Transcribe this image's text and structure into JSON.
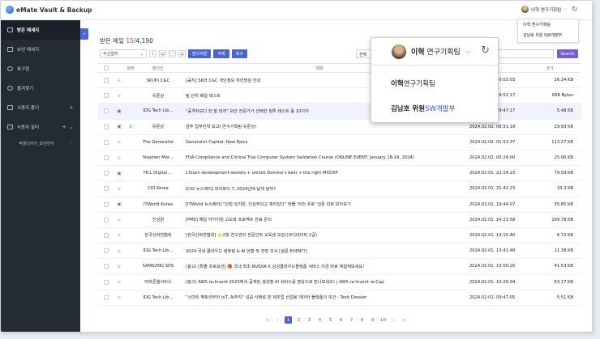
{
  "app": {
    "title": "eMate Vault & Backup"
  },
  "header": {
    "user": "이혁 연구기획팀",
    "caret": "⌵",
    "refresh": "↻"
  },
  "top_dropdown": {
    "items": [
      "이혁 연구기획팀",
      "김남호 위원 SW개발부"
    ]
  },
  "sidebar": {
    "items": [
      {
        "label": "받은 메세지"
      },
      {
        "label": "보낸 메세지"
      },
      {
        "label": "복구함"
      },
      {
        "label": "즐겨찾기"
      },
      {
        "label": "사용자 폴더",
        "plus": "+"
      },
      {
        "label": "사용자 필터",
        "plus": "+",
        "chevron": "⌄"
      }
    ],
    "sub": {
      "label": "액셀티어어_보낸편지",
      "dots": "⋮"
    }
  },
  "collapse_icon": "‹",
  "main": {
    "title": "받은 메일",
    "count_new": "15",
    "count_total": "/4,190"
  },
  "toolbar": {
    "sort": "수신일자",
    "sort_caret": "⌄",
    "down_arrow": "↓",
    "tools": [
      "▤",
      "▢",
      "▤"
    ],
    "btn_backup": "원다지원",
    "btn_delete": "삭제",
    "btn_restore": "복구",
    "search_scope": "전체",
    "search_button": "Search"
  },
  "table": {
    "headers": {
      "att": "첨부",
      "from": "발신인",
      "subject": "제목",
      "size": "크기"
    },
    "rows": [
      {
        "star": false,
        "att": "",
        "from": "SK(주) C&C",
        "subject": "[공지] SK와 C&C 개인정보 처리방침 안내",
        "date": "2024.02.02. 10:03:03",
        "size": "26.34 KB"
      },
      {
        "star": false,
        "att": "",
        "from": "유준상",
        "subject": "팀 단위 메일 테스트",
        "date": "2024.02.02. 09:52:17",
        "size": "668 Bytes"
      },
      {
        "star": true,
        "att": "",
        "from": "IDG Tech Lib…",
        "subject": "\"공격자보다 한 발 먼저\" 보안 전문가가 선택한 침투 테스트 툴 10가지",
        "date": "2024.02.02. 09:47:17",
        "size": "5.48 KB",
        "hl": true
      },
      {
        "star": true,
        "att": "⊘",
        "from": "유준상",
        "subject": "금주 업무진척 보고( 연구기획팀 유준상)",
        "date": "2024.02.02. 08:51:19",
        "size": "29.93 KB"
      },
      {
        "star": false,
        "att": "",
        "from": "The Generalist",
        "subject": "Generalist Capital: New Epics",
        "date": "2024.02.02. 01:53:37",
        "size": "113.27 KB"
      },
      {
        "star": false,
        "att": "",
        "from": "Stephen Mor…",
        "subject": "FDA Compliance and Clinical Trial Computer System Validation Course (ONLINE EVENT: January 18-19, 2024)",
        "date": "2024.02.02. 00:24:00",
        "size": "25.06 KB"
      },
      {
        "star": true,
        "att": "",
        "from": "HCL Digital …",
        "subject": "Citizen development secrets + unlock Domino's best + the right MXDXP",
        "date": "2024.02.01. 22:24:23",
        "size": "79.59 KB"
      },
      {
        "star": false,
        "att": "",
        "from": "CIO Korea",
        "subject": "[CIO 뉴스레터] 와이파이 7, 2024년에 날개 달까?",
        "date": "2024.02.01. 21:42:23",
        "size": "33.3 KB"
      },
      {
        "star": true,
        "att": "",
        "from": "ITWorld Korea",
        "subject": "[ITWorld 뉴스레터] \"단점 있지만, 인상적이고 재미있다\" 애플 '비전 프로' 언론 리뷰 모아보기",
        "date": "2024.02.01. 19:44:07",
        "size": "35.85 KB"
      },
      {
        "star": false,
        "att": "",
        "from": "진성원",
        "subject": "[PMS] 예일 아카이빙 고도화 프로젝트 완료 문의",
        "date": "2024.02.01. 14:23:58",
        "size": "199.78 KB"
      },
      {
        "star": false,
        "att": "",
        "from": "한국산학연협회",
        "subject": "[한국산학연협회] 🌟2월 연구관리 전문인력 교육생 모집!(코디네이터 2급)",
        "date": "2024.02.01. 14:15:40",
        "size": "6.72 KB"
      },
      {
        "star": false,
        "att": "",
        "from": "IDG Tech Lib…",
        "subject": "2024 국내 클라우드 컴퓨팅 & AI 현황 및 전망 조사 [설문 EVENT!]",
        "date": "2024.02.01. 13:41:48",
        "size": "11.38 KB"
      },
      {
        "star": false,
        "att": "",
        "from": "SAMSUNG SDS",
        "subject": "(광고) [특별 프로모션] 🎁 국내 최초 NVIDIA X 삼성클라우드플랫폼 서비스 지금 바로 체험해보세요!",
        "date": "2024.02.01. 13:00:26",
        "size": "41.53 KB"
      },
      {
        "star": false,
        "att": "",
        "from": "아마존웹서비스",
        "subject": "(광고) AWS re:Invent 2023에서 공개된 생성형 AI 서비스를 영상으로 만나보세요! | AWS re:Invent re:Cap",
        "date": "2024.02.01. 10:09:04",
        "size": "63.17 KB"
      },
      {
        "star": false,
        "att": "",
        "from": "IDG Tech Lib…",
        "subject": "\"스마트 팩토리부터 IoT, AI까지\" 성공 사례로 본 제조업 산업용 데이터 플랫폼의 조건 - Tech Dossier",
        "date": "2024.02.01. 09:47:05",
        "size": "5.51 KB"
      }
    ]
  },
  "pager": {
    "prev2": "«",
    "prev": "‹",
    "pages": [
      "1",
      "2",
      "3",
      "4",
      "5",
      "6",
      "7",
      "8",
      "9",
      "10"
    ],
    "next": "›",
    "next2": "»"
  },
  "popup": {
    "head_name_bold": "이혁",
    "head_name_rest": " 연구기획팀",
    "caret": "⌵",
    "refresh": "↻",
    "items": [
      {
        "bold": "이혁",
        "rest": " 연구기획팀",
        "blue": ""
      },
      {
        "bold": "김남호 위원",
        "rest": " ",
        "blue": "SW개발부"
      }
    ]
  }
}
